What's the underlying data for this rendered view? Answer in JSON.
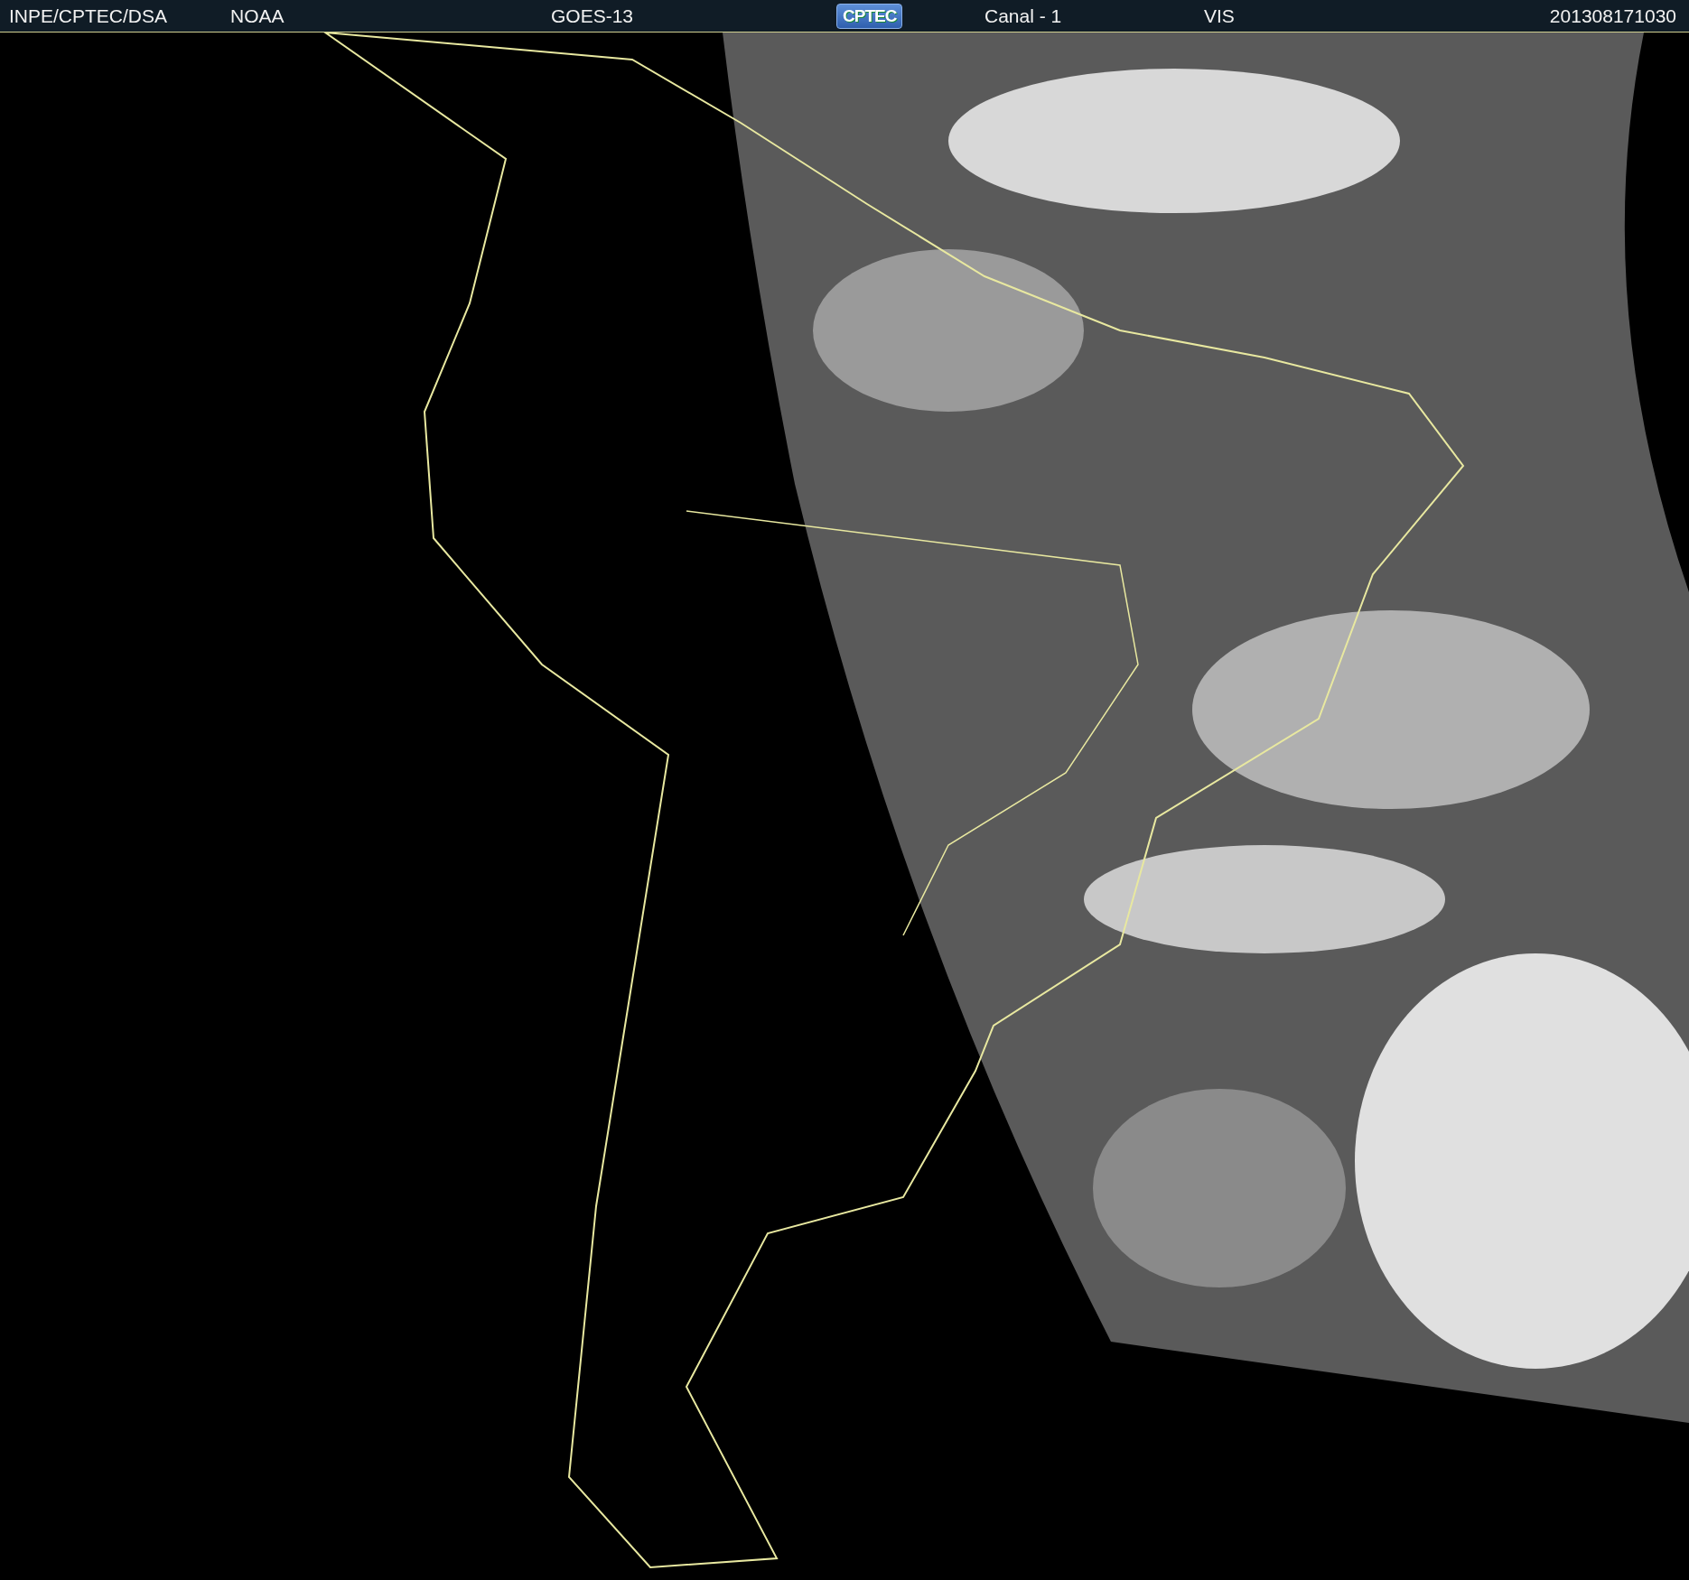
{
  "header": {
    "items": [
      {
        "kind": "text",
        "text": "INPE/CPTEC/DSA"
      },
      {
        "kind": "text",
        "text": "NOAA"
      },
      {
        "kind": "text",
        "text": "GOES-13"
      },
      {
        "kind": "logo",
        "text": "CPTEC"
      },
      {
        "kind": "text",
        "text": "Canal - 1"
      },
      {
        "kind": "text",
        "text": "VIS"
      },
      {
        "kind": "text",
        "text": "201308171030"
      }
    ]
  }
}
